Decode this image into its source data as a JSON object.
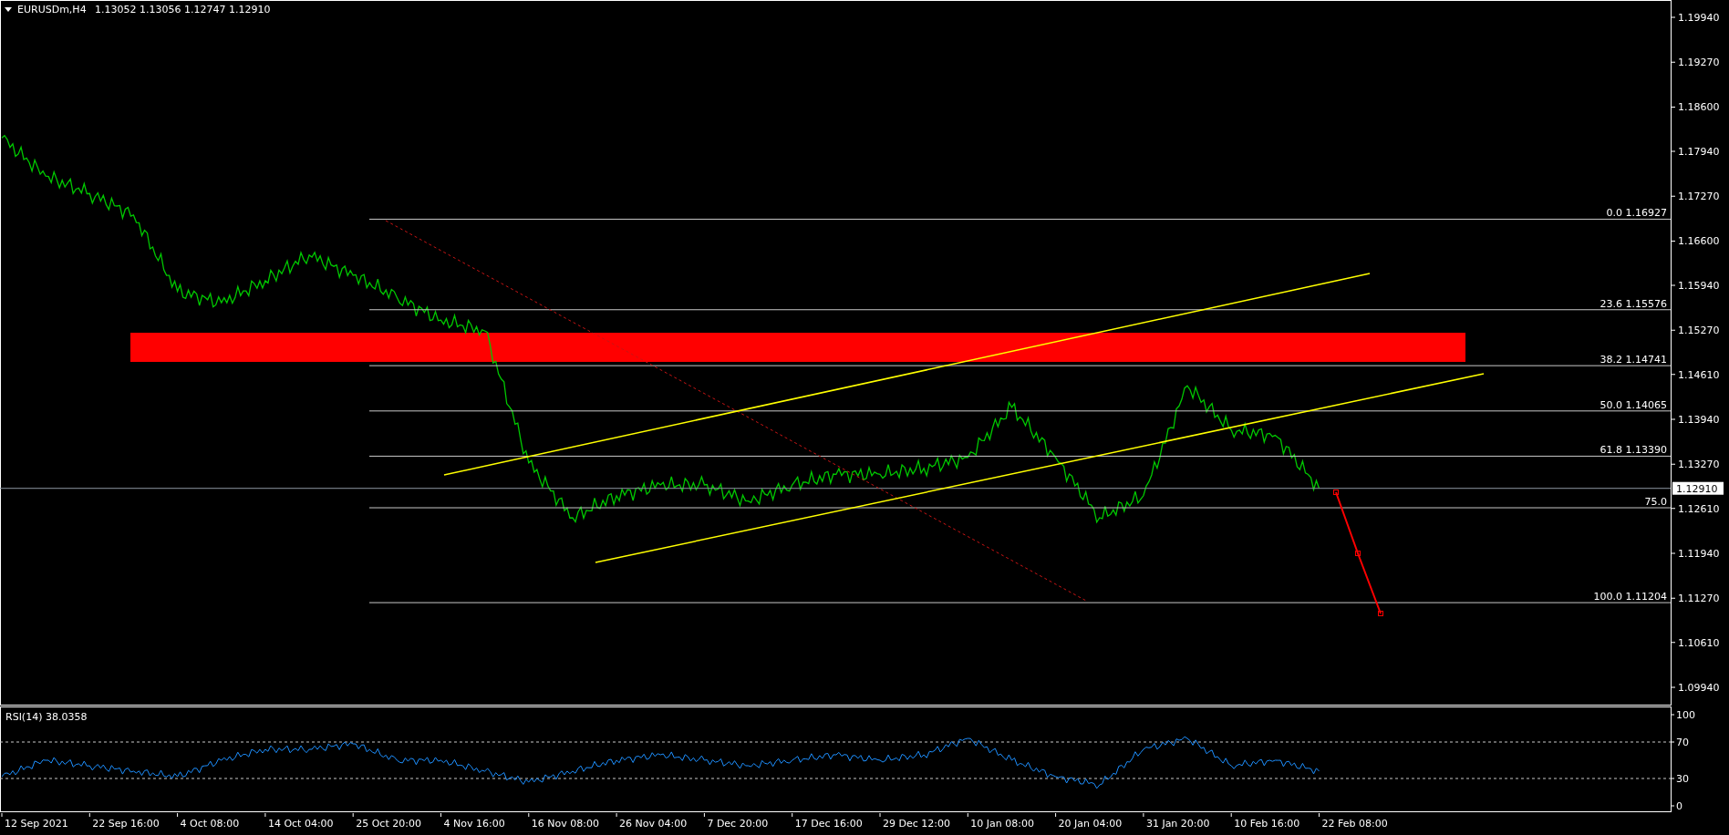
{
  "header": {
    "symbol": "EURUSDm,H4",
    "quote": "1.13052 1.13056 1.12747 1.12910"
  },
  "price_chart": {
    "fibonacci_levels": [
      "0.0 1.16927",
      "23.6 1.15576",
      "38.2 1.14741",
      "50.0 1.14065",
      "61.8 1.13390",
      "75.0",
      "100.0 1.11204"
    ],
    "current_price": "1.12910",
    "price_axis": [
      "1.19940",
      "1.19270",
      "1.18600",
      "1.17940",
      "1.17270",
      "1.16600",
      "1.15940",
      "1.15270",
      "1.14610",
      "1.13940",
      "1.13270",
      "1.12610",
      "1.11940",
      "1.11270",
      "1.10610",
      "1.09940"
    ]
  },
  "rsi_panel": {
    "title": "RSI(14) 38.0358",
    "axis": [
      "100",
      "70",
      "30",
      "0"
    ]
  },
  "date_axis": [
    "12 Sep 2021",
    "22 Sep 16:00",
    "4 Oct 08:00",
    "14 Oct 04:00",
    "25 Oct 20:00",
    "4 Nov 16:00",
    "16 Nov 08:00",
    "26 Nov 04:00",
    "7 Dec 20:00",
    "17 Dec 16:00",
    "29 Dec 12:00",
    "10 Jan 08:00",
    "20 Jan 04:00",
    "31 Jan 20:00",
    "10 Feb 16:00",
    "22 Feb 08:00"
  ]
}
